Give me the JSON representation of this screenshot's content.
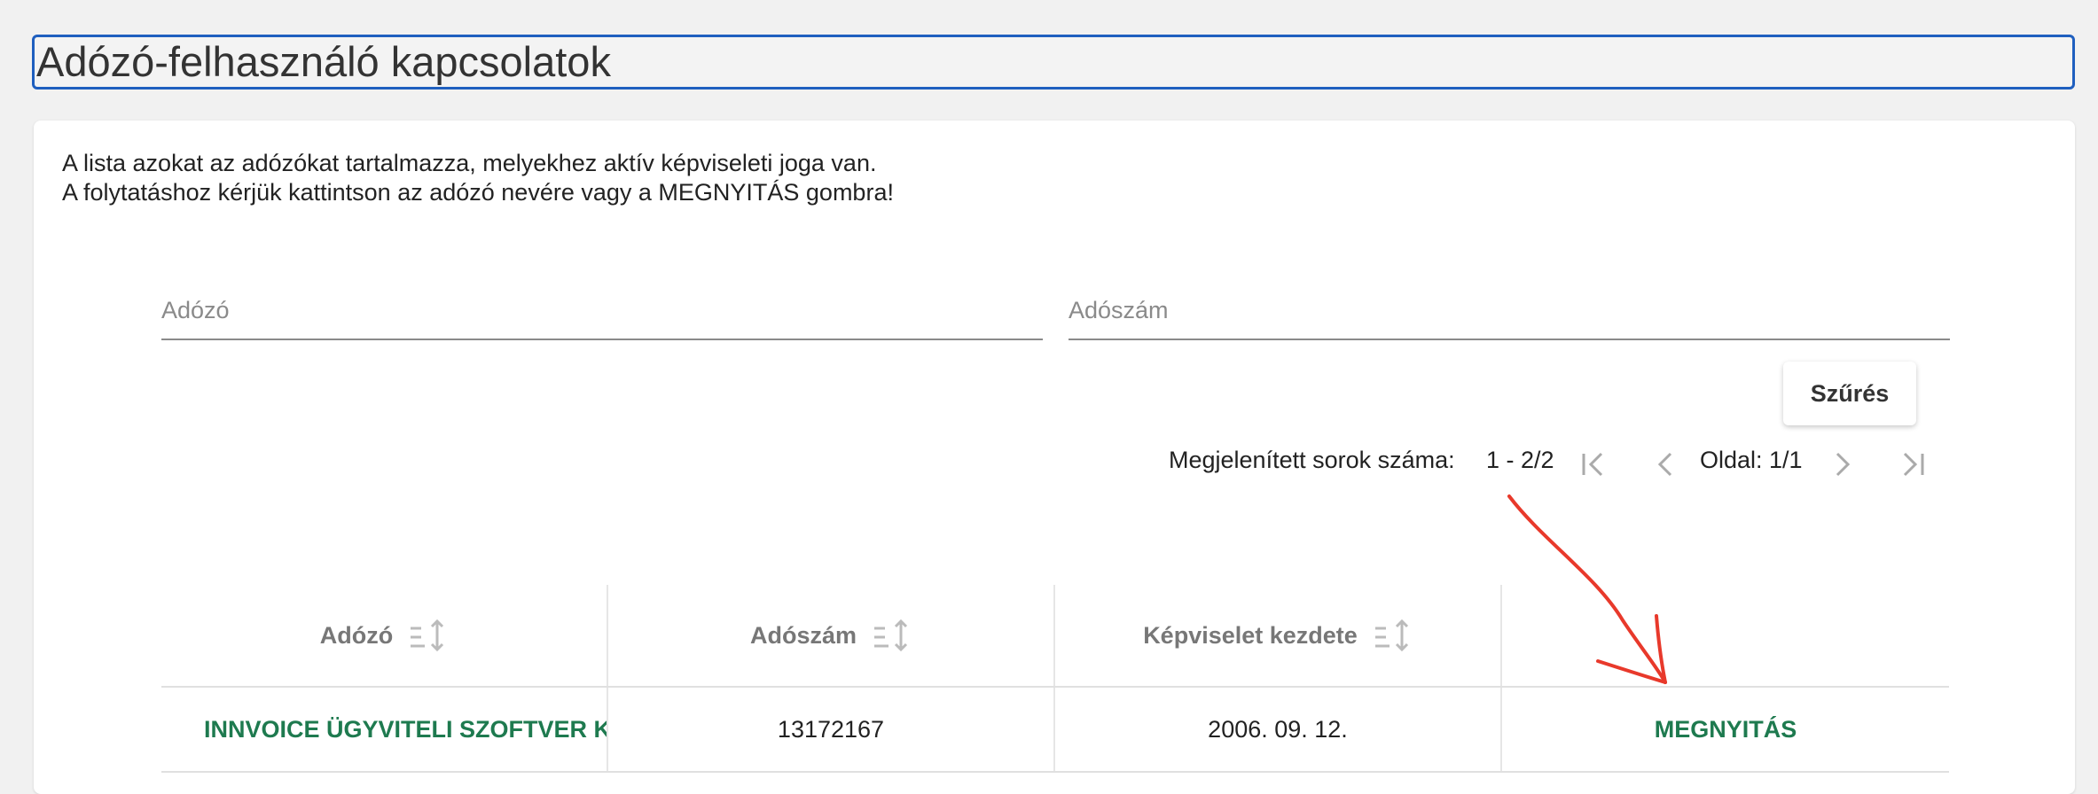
{
  "page": {
    "title": "Adózó-felhasználó kapcsolatok"
  },
  "intro": {
    "line1": "A lista azokat az adózókat tartalmazza, melyekhez aktív képviseleti joga van.",
    "line2": "A folytatáshoz kérjük kattintson az adózó nevére vagy a MEGNYITÁS gombra!"
  },
  "filters": {
    "taxpayer_placeholder": "Adózó",
    "tax_number_placeholder": "Adószám",
    "taxpayer_value": "",
    "tax_number_value": "",
    "filter_button": "Szűrés"
  },
  "pager": {
    "rows_label": "Megjelenített sorok száma:",
    "rows_value": "1 - 2/2",
    "page_label": "Oldal: 1/1",
    "icons": [
      "first-page-icon",
      "prev-page-icon",
      "next-page-icon",
      "last-page-icon"
    ]
  },
  "table": {
    "columns": [
      "Adózó",
      "Adószám",
      "Képviselet kezdete",
      ""
    ],
    "rows": [
      {
        "taxpayer": "INNVOICE ÜGYVITELI SZOFTVER K",
        "tax_number": "13172167",
        "start_date": "2006. 09. 12.",
        "action": "MEGNYITÁS"
      }
    ]
  },
  "colors": {
    "link": "#1e7a4f",
    "title_border": "#1f5fbf",
    "annotation": "#e8392b"
  }
}
